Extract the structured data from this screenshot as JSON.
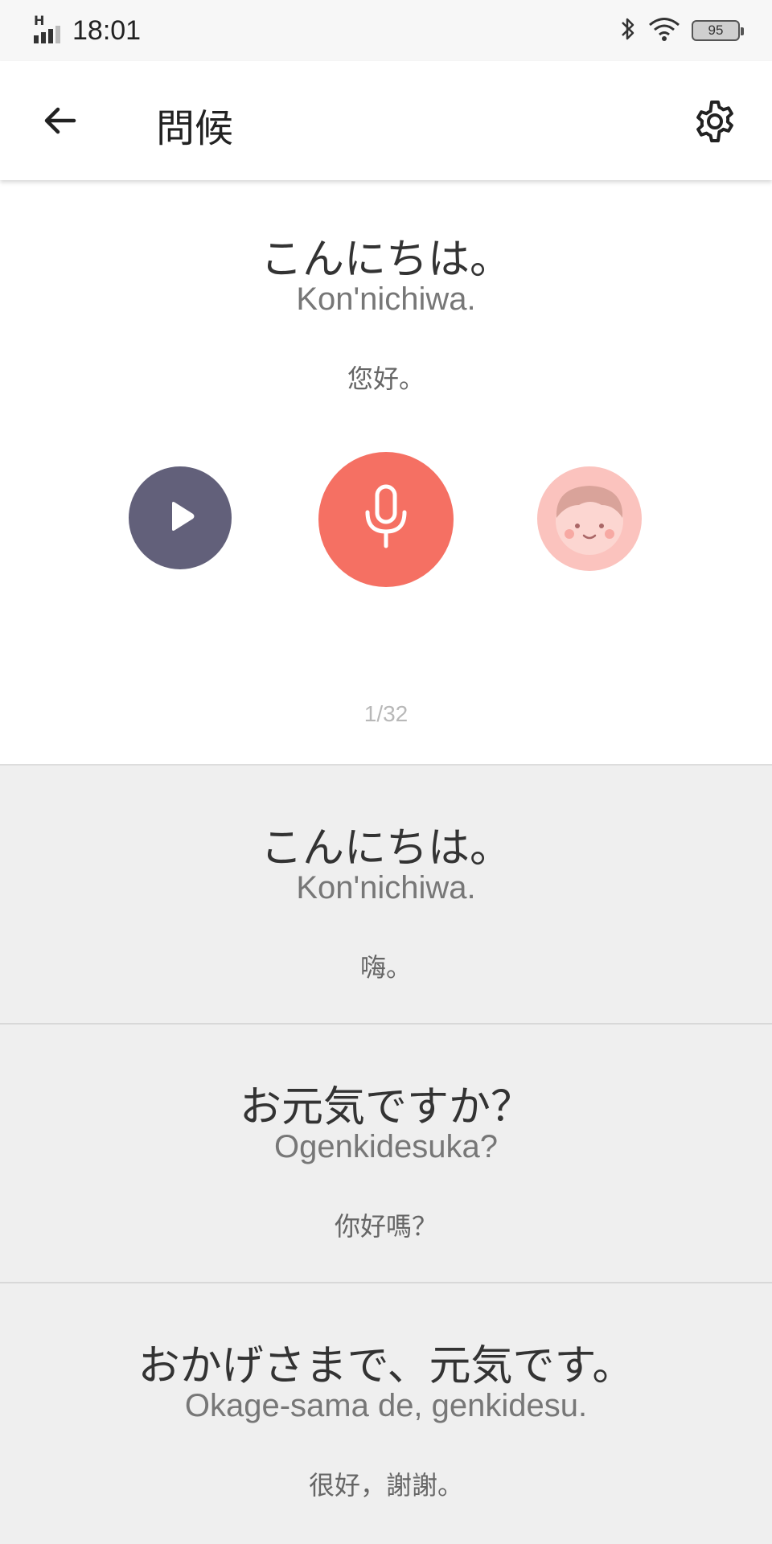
{
  "status_bar": {
    "network_letter": "H",
    "time": "18:01",
    "battery_level": "95",
    "icons": [
      "signal-icon",
      "bluetooth-icon",
      "wifi-icon",
      "battery-icon"
    ]
  },
  "app_bar": {
    "title": "問候",
    "icons": [
      "back-arrow-icon",
      "gear-icon"
    ]
  },
  "current_phrase": {
    "japanese": "こんにちは。",
    "romaji": "Kon'nichiwa.",
    "translation": "您好。",
    "counter": "1/32",
    "controls": [
      "play-icon",
      "microphone-icon",
      "avatar-icon"
    ]
  },
  "colors": {
    "play_button": "#62607a",
    "mic_button": "#f57063",
    "avatar_button": "#fbc3be",
    "list_background": "#efefef"
  },
  "phrases": [
    {
      "japanese": "こんにちは。",
      "romaji": "Kon'nichiwa.",
      "translation": "嗨。"
    },
    {
      "japanese": "お元気ですか？",
      "romaji": "Ogenkidesuka?",
      "translation": "你好嗎？"
    },
    {
      "japanese": "おかげさまで、元気です。",
      "romaji": "Okage-sama de, genkidesu.",
      "translation": "很好，謝謝。"
    }
  ]
}
